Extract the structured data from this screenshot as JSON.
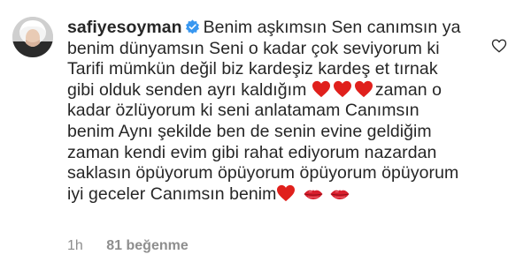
{
  "comment": {
    "username": "safiyesoyman",
    "verified": true,
    "segments": {
      "s1": "Benim aşkımsın Sen canımsın ya benim dünyamsın Seni o kadar çok seviyorum ki Tarifi mümkün değil biz kardeşiz kardeş et tırnak gibi olduk senden ayrı kaldığım ",
      "s2": "zaman o kadar özlüyorum ki seni anlatamam Canımsın benim Aynı şekilde ben de senin evine geldiğim zaman kendi evim gibi rahat ediyorum nazardan saklasın öpüyorum öpüyorum öpüyorum öpüyorum iyi geceler Canımsın benim"
    },
    "emojis_after_s1": [
      "heart-icon",
      "heart-icon",
      "heart-icon"
    ],
    "emojis_after_s2": [
      "heart-icon",
      "kiss-icon",
      "kiss-icon"
    ],
    "time": "1h",
    "likes": "81 beğenme"
  },
  "colors": {
    "text": "#262626",
    "muted": "#8e8e8e",
    "verified_blue": "#3897f0",
    "heart_red": "#e0201c",
    "kiss_red": "#d81e2c"
  }
}
